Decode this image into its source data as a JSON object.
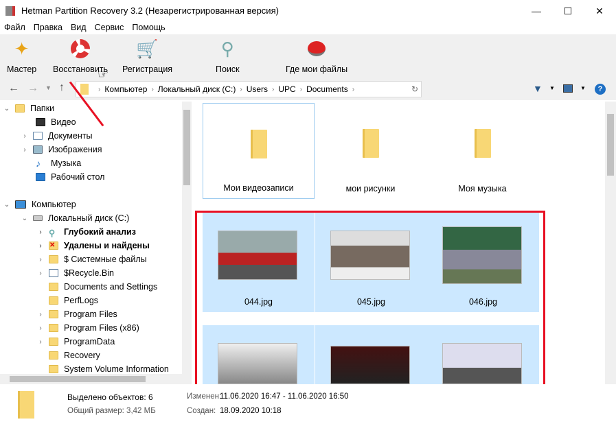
{
  "window": {
    "title": "Hetman Partition Recovery 3.2 (Незарегистрированная версия)"
  },
  "menu": [
    "Файл",
    "Правка",
    "Вид",
    "Сервис",
    "Помощь"
  ],
  "toolbar": {
    "wizard": "Мастер",
    "restore": "Восстановить",
    "register": "Регистрация",
    "search": "Поиск",
    "where": "Где мои файлы"
  },
  "address": {
    "crumbs": [
      "Компьютер",
      "Локальный диск (C:)",
      "Users",
      "UPC",
      "Documents"
    ]
  },
  "tree": {
    "folders": "Папки",
    "video": "Видео",
    "docs": "Документы",
    "images": "Изображения",
    "music": "Музыка",
    "desktop": "Рабочий стол",
    "computer": "Компьютер",
    "disk": "Локальный диск (C:)",
    "children": [
      "Глубокий анализ",
      "Удалены и найдены",
      "$ Системные файлы",
      "$Recycle.Bin",
      "Documents and Settings",
      "PerfLogs",
      "Program Files",
      "Program Files (x86)",
      "ProgramData",
      "Recovery",
      "System Volume Information"
    ]
  },
  "files": {
    "folders": [
      "Мои видеозаписи",
      "мои рисунки",
      "Моя музыка"
    ],
    "images": [
      "044.jpg",
      "045.jpg",
      "046.jpg"
    ]
  },
  "status": {
    "selected": "Выделено объектов: 6",
    "size": "Общий размер: 3,42 МБ",
    "modified_label": "Изменен:",
    "modified": "11.06.2020 16:47 - 11.06.2020 16:50",
    "created_label": "Создан:",
    "created": "18.09.2020 10:18"
  },
  "colors": {
    "selection": "#cce8ff",
    "highlight": "#e81123"
  }
}
